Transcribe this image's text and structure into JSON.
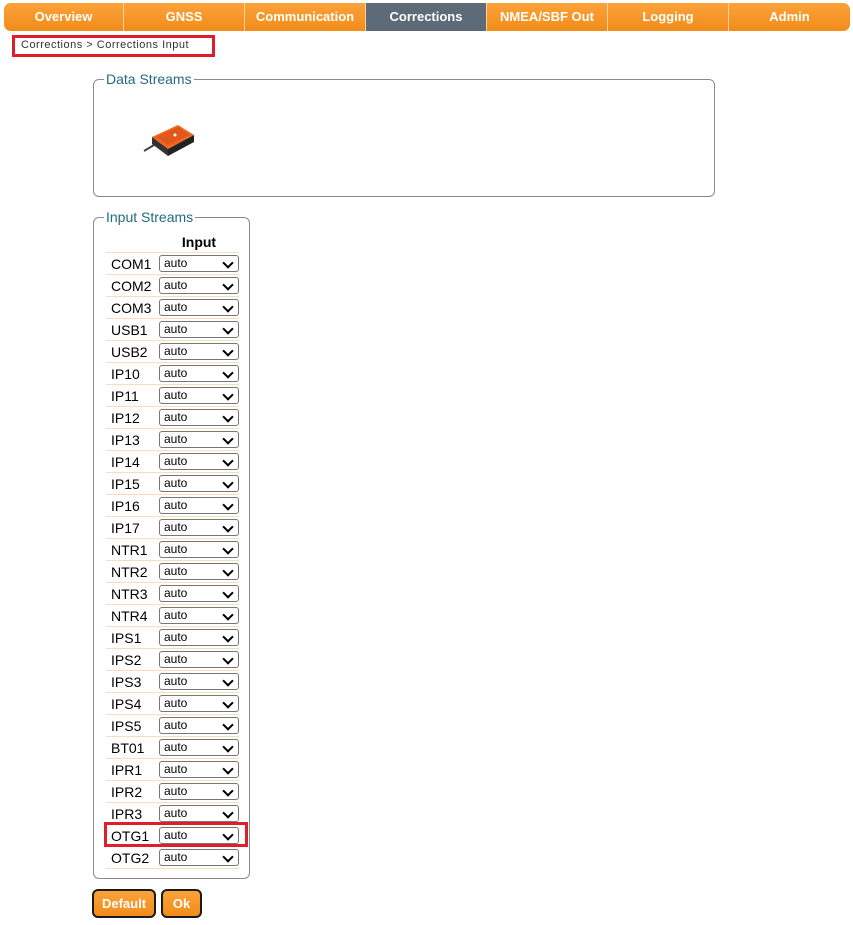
{
  "nav": {
    "tabs": [
      {
        "label": "Overview"
      },
      {
        "label": "GNSS"
      },
      {
        "label": "Communication"
      },
      {
        "label": "Corrections",
        "active": true
      },
      {
        "label": "NMEA/SBF Out"
      },
      {
        "label": "Logging"
      },
      {
        "label": "Admin"
      }
    ]
  },
  "breadcrumb": "Corrections > Corrections Input",
  "data_streams": {
    "legend": "Data Streams",
    "device_icon": "receiver-device-icon"
  },
  "input_streams": {
    "legend": "Input Streams",
    "column_header": "Input",
    "rows": [
      {
        "port": "COM1",
        "value": "auto"
      },
      {
        "port": "COM2",
        "value": "auto"
      },
      {
        "port": "COM3",
        "value": "auto"
      },
      {
        "port": "USB1",
        "value": "auto"
      },
      {
        "port": "USB2",
        "value": "auto"
      },
      {
        "port": "IP10",
        "value": "auto"
      },
      {
        "port": "IP11",
        "value": "auto"
      },
      {
        "port": "IP12",
        "value": "auto"
      },
      {
        "port": "IP13",
        "value": "auto"
      },
      {
        "port": "IP14",
        "value": "auto"
      },
      {
        "port": "IP15",
        "value": "auto"
      },
      {
        "port": "IP16",
        "value": "auto"
      },
      {
        "port": "IP17",
        "value": "auto"
      },
      {
        "port": "NTR1",
        "value": "auto"
      },
      {
        "port": "NTR2",
        "value": "auto"
      },
      {
        "port": "NTR3",
        "value": "auto"
      },
      {
        "port": "NTR4",
        "value": "auto"
      },
      {
        "port": "IPS1",
        "value": "auto"
      },
      {
        "port": "IPS2",
        "value": "auto"
      },
      {
        "port": "IPS3",
        "value": "auto"
      },
      {
        "port": "IPS4",
        "value": "auto"
      },
      {
        "port": "IPS5",
        "value": "auto"
      },
      {
        "port": "BT01",
        "value": "auto"
      },
      {
        "port": "IPR1",
        "value": "auto"
      },
      {
        "port": "IPR2",
        "value": "auto"
      },
      {
        "port": "IPR3",
        "value": "auto"
      },
      {
        "port": "OTG1",
        "value": "auto"
      },
      {
        "port": "OTG2",
        "value": "auto"
      }
    ]
  },
  "buttons": {
    "default_label": "Default",
    "ok_label": "Ok"
  },
  "colors": {
    "accent": "#f7941d",
    "active_tab": "#5d6b78",
    "legend_text": "#226a84",
    "highlight": "#e01e2b"
  }
}
